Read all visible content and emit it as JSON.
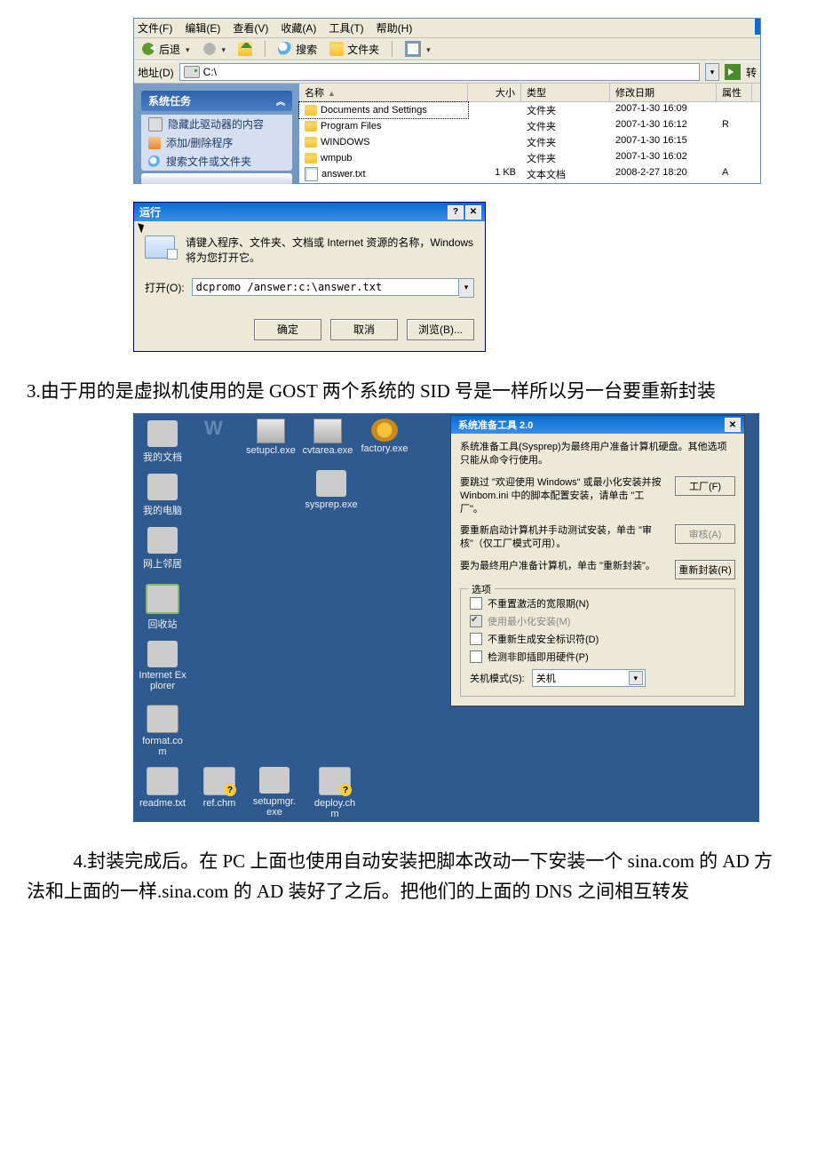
{
  "menubar": {
    "file": "文件(F)",
    "edit": "编辑(E)",
    "view": "查看(V)",
    "fav": "收藏(A)",
    "tools": "工具(T)",
    "help": "帮助(H)"
  },
  "toolbar": {
    "back": "后退",
    "search": "搜索",
    "folders": "文件夹"
  },
  "addressbar": {
    "label": "地址(D)",
    "value": "C:\\",
    "go": "转"
  },
  "tasks": {
    "header": "系统任务",
    "items": [
      "隐藏此驱动器的内容",
      "添加/删除程序",
      "搜索文件或文件夹"
    ]
  },
  "columns": {
    "name": "名称",
    "size": "大小",
    "type": "类型",
    "date": "修改日期",
    "attr": "属性"
  },
  "files": [
    {
      "name": "Documents and Settings",
      "size": "",
      "type": "文件夹",
      "date": "2007-1-30 16:09",
      "attr": "",
      "sel": true
    },
    {
      "name": "Program Files",
      "size": "",
      "type": "文件夹",
      "date": "2007-1-30 16:12",
      "attr": "R"
    },
    {
      "name": "WINDOWS",
      "size": "",
      "type": "文件夹",
      "date": "2007-1-30 16:15",
      "attr": ""
    },
    {
      "name": "wmpub",
      "size": "",
      "type": "文件夹",
      "date": "2007-1-30 16:02",
      "attr": ""
    },
    {
      "name": "answer.txt",
      "size": "1 KB",
      "type": "文本文档",
      "date": "2008-2-27 18:20",
      "attr": "A",
      "icon": "txt"
    }
  ],
  "run": {
    "title": "运行",
    "desc": "请键入程序、文件夹、文档或 Internet 资源的名称，Windows 将为您打开它。",
    "open_label": "打开(O):",
    "value": "dcpromo /answer:c:\\answer.txt",
    "ok": "确定",
    "cancel": "取消",
    "browse": "浏览(B)..."
  },
  "para3": "3.由于用的是虚拟机使用的是 GOST 两个系统的 SID 号是一样所以另一台要重新封装",
  "desktop": {
    "icons": {
      "docs": "我的文档",
      "pc": "我的电脑",
      "net": "网上邻居",
      "bin": "回收站",
      "ie": "Internet Explorer",
      "fmt": "format.com",
      "readme": "readme.txt",
      "ref": "ref.chm",
      "setupmgr": "setupmgr.exe",
      "deploy": "deploy.chm",
      "setupcl": "setupcl.exe",
      "cvtarea": "cvtarea.exe",
      "factory": "factory.exe",
      "sysprep": "sysprep.exe"
    }
  },
  "sysprep": {
    "title": "系统准备工具 2.0",
    "intro": "系统准备工具(Sysprep)为最终用户准备计算机硬盘。其他选项只能从命令行使用。",
    "r1": "要跳过 \"欢迎使用 Windows\" 或最小化安装并按 Winbom.ini 中的脚本配置安装，请单击 \"工厂\"。",
    "b1": "工厂(F)",
    "r2": "要重新启动计算机并手动测试安装，单击 \"审核\"（仅工厂模式可用）。",
    "b2": "审核(A)",
    "r3": "要为最终用户准备计算机，单击 \"重新封装\"。",
    "b3": "重新封装(R)",
    "legend": "选项",
    "c1": "不重置激活的宽限期(N)",
    "c2": "使用最小化安装(M)",
    "c3": "不重新生成安全标识符(D)",
    "c4": "检测非即插即用硬件(P)",
    "shutdown_label": "关机模式(S):",
    "shutdown_val": "关机"
  },
  "para4": "4.封装完成后。在 PC 上面也使用自动安装把脚本改动一下安装一个 sina.com 的 AD 方法和上面的一样.sina.com 的 AD 装好了之后。把他们的上面的 DNS 之间相互转发"
}
